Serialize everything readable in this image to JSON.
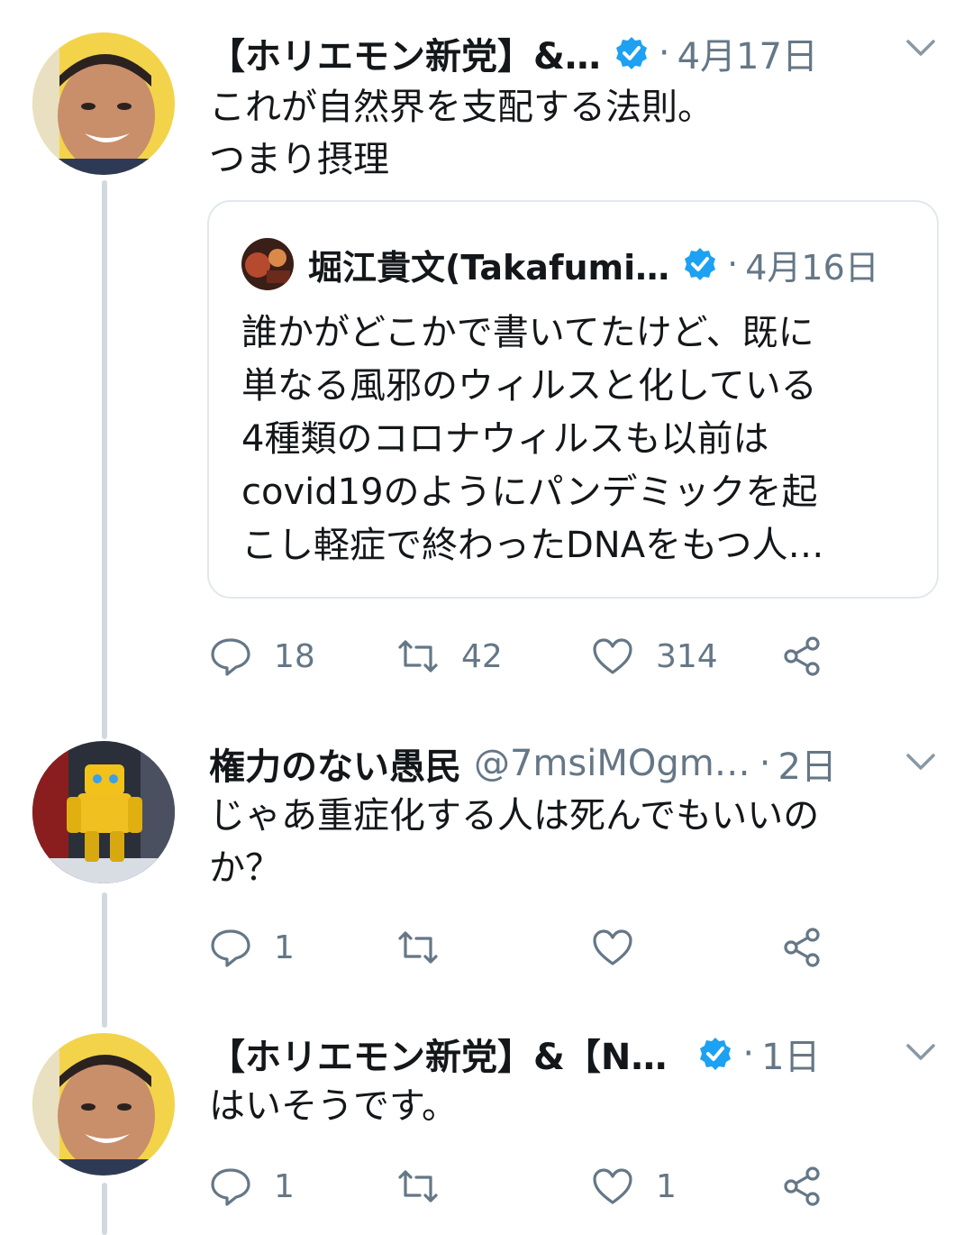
{
  "tweets": [
    {
      "name": "【ホリエモン新党】&…",
      "verified": true,
      "dot": "·",
      "time": "4月17日",
      "text_lines": [
        "これが自然界を支配する法則。",
        "つまり摂理"
      ],
      "quote": {
        "name": "堀江貴文(Takafumi…",
        "verified": true,
        "dot": "·",
        "time": "4月16日",
        "text_lines": [
          "誰かがどこかで書いてたけど、既に",
          "単なる風邪のウィルスと化している",
          "4種類のコロナウィルスも以前は",
          "covid19のようにパンデミックを起",
          "こし軽症で終わったDNAをもつ人…"
        ]
      },
      "actions": {
        "reply": "18",
        "retweet": "42",
        "like": "314"
      }
    },
    {
      "name": "権力のない愚民",
      "handle": "@7msiMOgm…",
      "dot": "·",
      "time": "2日",
      "text_lines": [
        "じゃあ重症化する人は死んでもいいの",
        "か？"
      ],
      "actions": {
        "reply": "1",
        "retweet": "",
        "like": ""
      }
    },
    {
      "name": "【ホリエモン新党】&【N…",
      "verified": true,
      "dot": "·",
      "time": "1日",
      "text_lines": [
        "はいそうです。"
      ],
      "actions": {
        "reply": "1",
        "retweet": "",
        "like": "1"
      }
    }
  ],
  "colors": {
    "verified": "#1da1f2",
    "muted": "#657786",
    "thread_line": "#cfd9de"
  }
}
